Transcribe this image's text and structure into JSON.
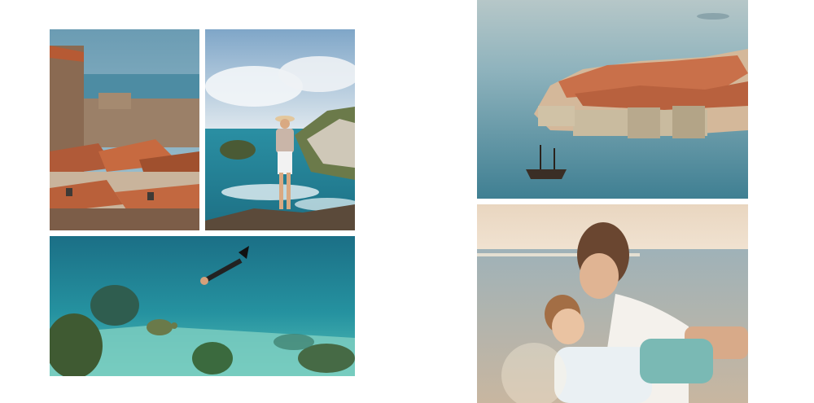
{
  "spread": {
    "background": "#ffffff",
    "left_page": {
      "photos": [
        {
          "subject": "old-town-rooftops-icon",
          "palette": [
            "#c9643a",
            "#8a6a55",
            "#5a8aa0"
          ]
        },
        {
          "subject": "woman-on-cliff-icon",
          "palette": [
            "#2a8fa3",
            "#e8eef2",
            "#6b8a4a"
          ]
        },
        {
          "subject": "snorkeler-with-turtle-icon",
          "palette": [
            "#1f8a95",
            "#3fb2b0",
            "#4a6a3a"
          ]
        }
      ]
    },
    "right_page": {
      "photos": [
        {
          "subject": "walled-city-with-ship-icon",
          "palette": [
            "#8fb3bd",
            "#c9704a",
            "#d8d2c4"
          ]
        },
        {
          "subject": "mother-and-child-beach-icon",
          "palette": [
            "#e9d6c0",
            "#8aa5b0",
            "#ffffff"
          ]
        }
      ]
    }
  }
}
